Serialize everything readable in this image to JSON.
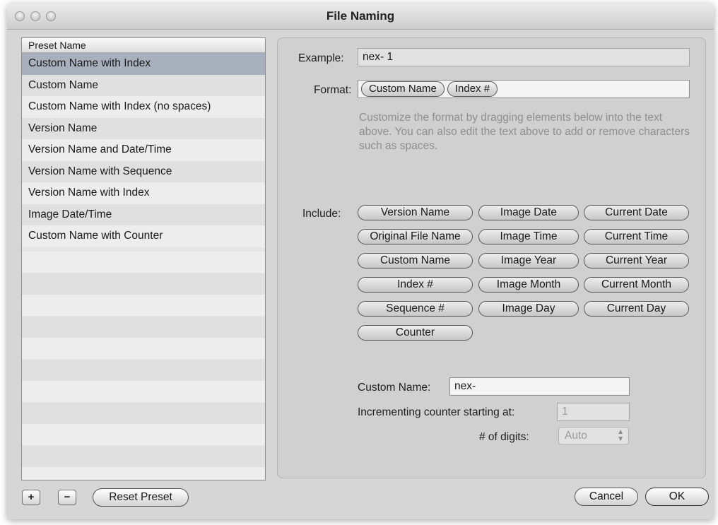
{
  "window": {
    "title": "File Naming"
  },
  "presets": {
    "header": "Preset Name",
    "items": [
      "Custom Name with Index",
      "Custom Name",
      "Custom Name with Index (no spaces)",
      "Version Name",
      "Version Name and Date/Time",
      "Version Name with Sequence",
      "Version Name with Index",
      "Image Date/Time",
      "Custom Name with Counter"
    ],
    "selected_index": 0
  },
  "bottom": {
    "add": "+",
    "remove": "−",
    "reset": "Reset Preset",
    "cancel": "Cancel",
    "ok": "OK"
  },
  "editor": {
    "example_label": "Example:",
    "example_value": "nex- 1",
    "format_label": "Format:",
    "format_tokens": [
      "Custom Name",
      "Index #"
    ],
    "help_text": "Customize the format by dragging elements below into the text above. You can also edit the text above to add or remove characters such as spaces.",
    "include_label": "Include:",
    "include_columns": [
      [
        "Version Name",
        "Original File Name",
        "Custom Name",
        "Index #",
        "Sequence #",
        "Counter"
      ],
      [
        "Image Date",
        "Image Time",
        "Image Year",
        "Image Month",
        "Image Day"
      ],
      [
        "Current Date",
        "Current Time",
        "Current Year",
        "Current Month",
        "Current Day"
      ]
    ],
    "custom_name_label": "Custom Name:",
    "custom_name_value": "nex-",
    "counter_label": "Incrementing counter starting at:",
    "counter_value": "1",
    "digits_label": "# of digits:",
    "digits_value": "Auto"
  }
}
